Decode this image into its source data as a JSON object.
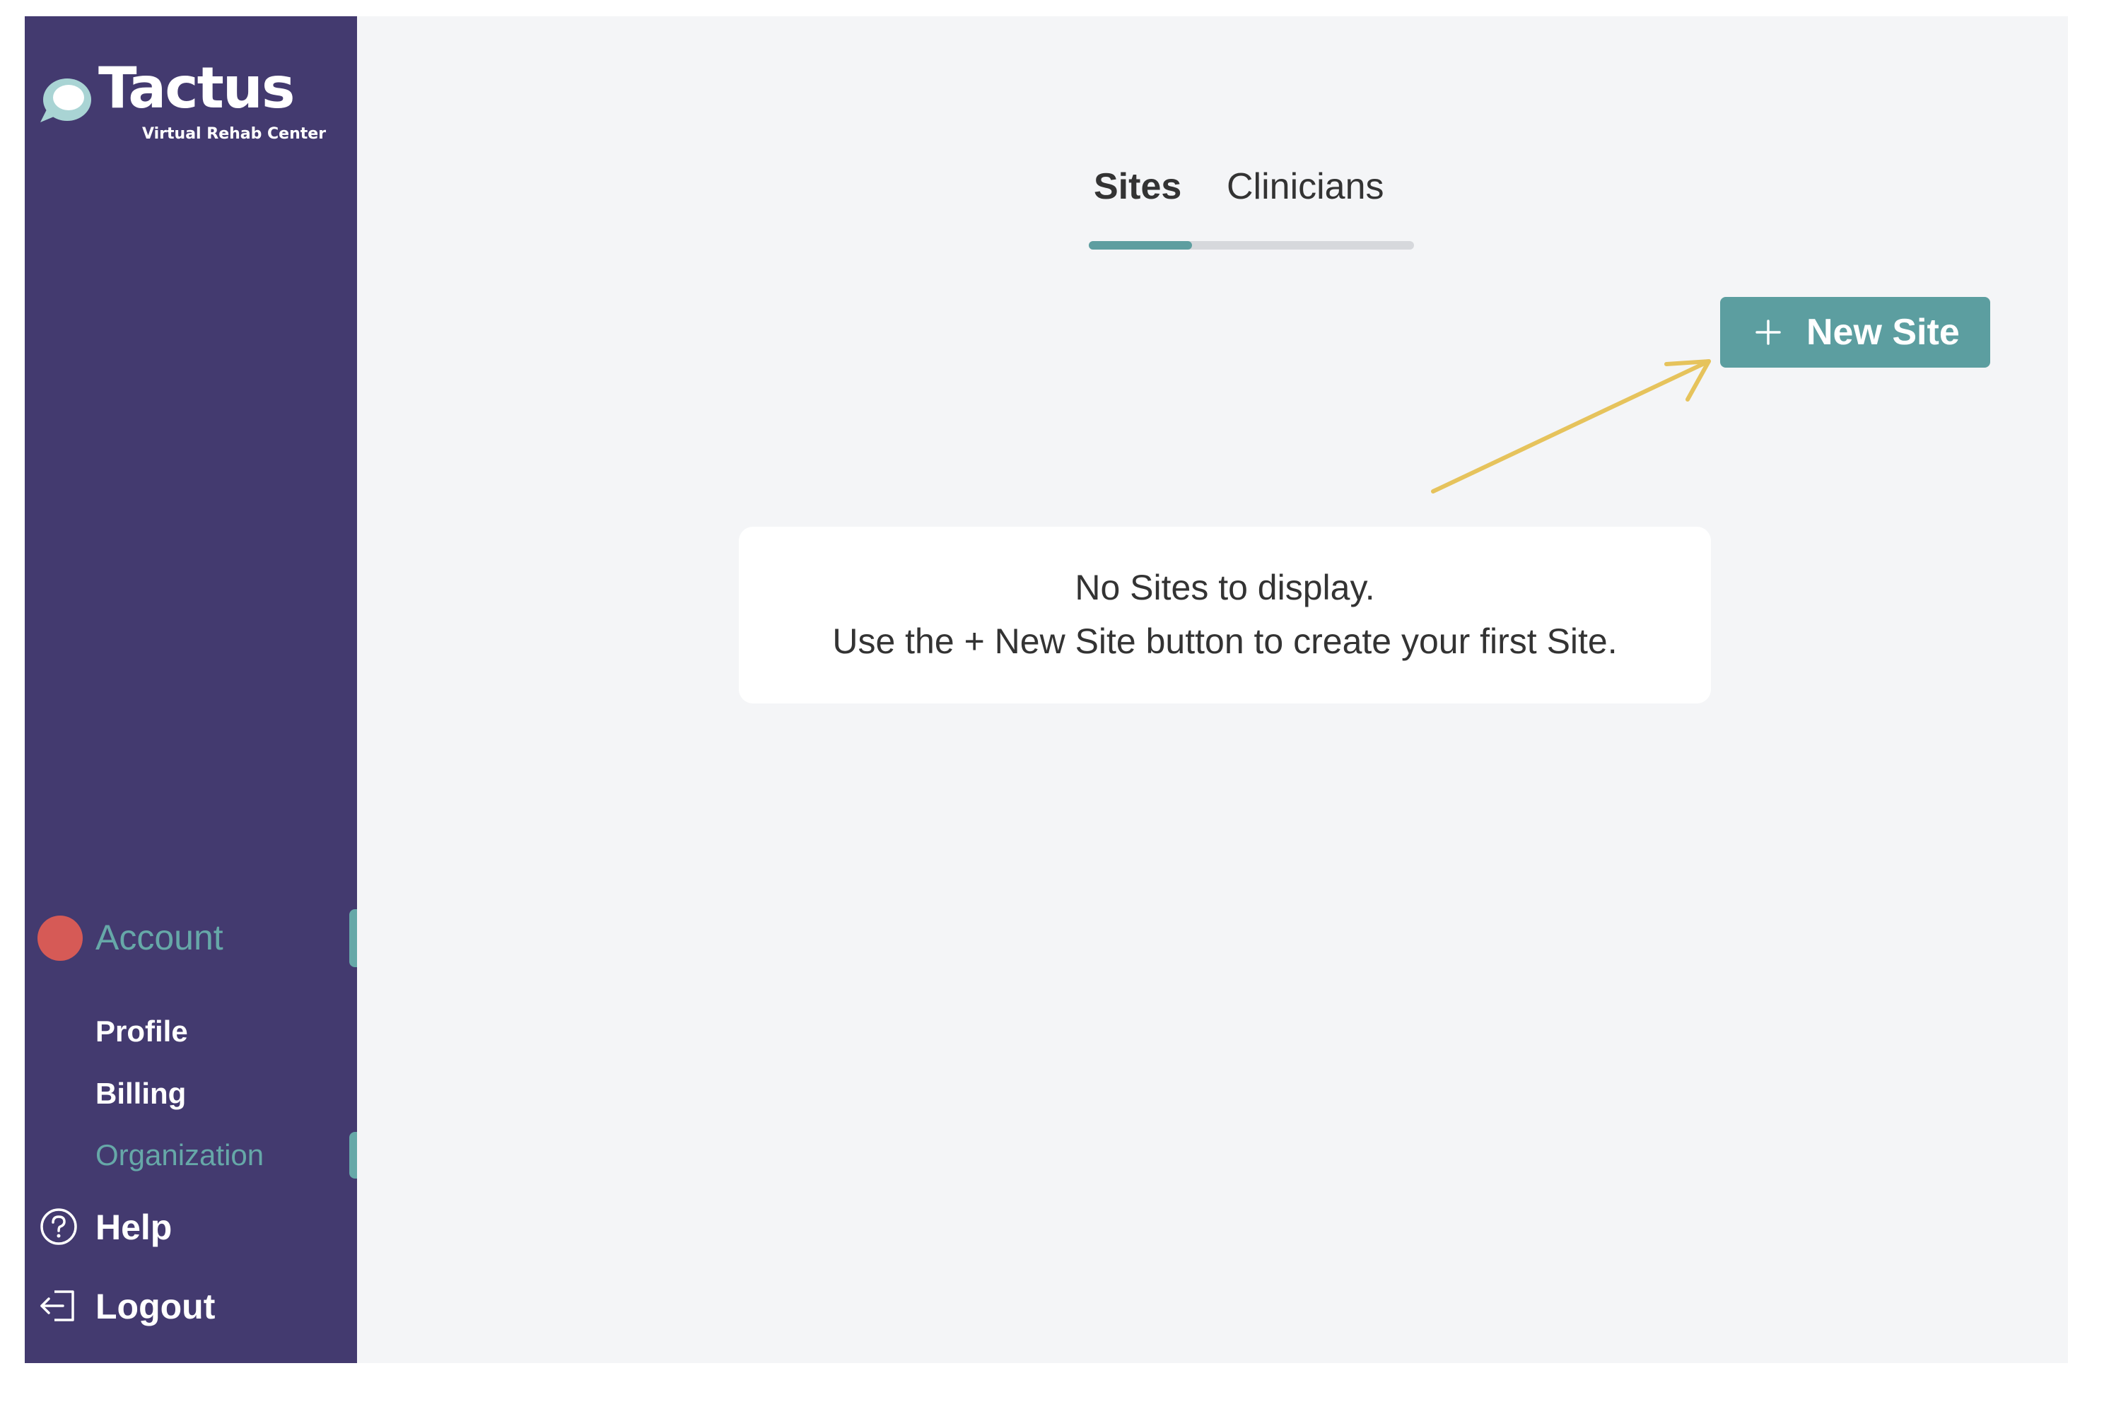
{
  "brand": {
    "name": "Tactus",
    "subtitle": "Virtual Rehab Center"
  },
  "sidebar": {
    "account_label": "Account",
    "account_items": [
      {
        "label": "Profile"
      },
      {
        "label": "Billing"
      },
      {
        "label": "Organization",
        "active": true
      }
    ],
    "help_label": "Help",
    "logout_label": "Logout",
    "icons": {
      "account": "avatar-dot",
      "help": "question-circle-icon",
      "logout": "logout-icon"
    }
  },
  "main": {
    "tabs": [
      {
        "label": "Sites",
        "active": true
      },
      {
        "label": "Clinicians",
        "active": false
      }
    ],
    "new_site_button": {
      "label": "New Site",
      "icon": "plus-icon"
    },
    "empty_state": {
      "line1": "No Sites to display.",
      "line2": "Use the + New Site button to create your first Site."
    }
  },
  "colors": {
    "sidebar_bg": "#433a6f",
    "accent_teal": "#5c9ea0",
    "active_text": "#66a8a8",
    "avatar_red": "#d65a56",
    "annotation_yellow": "#e6c35c",
    "content_bg": "#f4f5f7"
  }
}
